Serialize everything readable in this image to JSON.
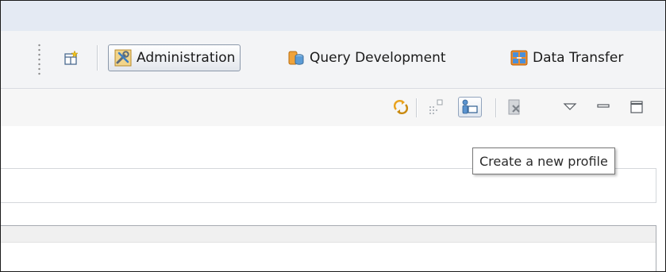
{
  "perspective_bar": {
    "items": [
      {
        "label": "Administration",
        "icon": "administration-icon",
        "active": true
      },
      {
        "label": "Query Development",
        "icon": "query-development-icon",
        "active": false
      },
      {
        "label": "Data Transfer",
        "icon": "data-transfer-icon",
        "active": false
      }
    ],
    "open_perspective_icon": "open-perspective-icon"
  },
  "view_toolbar": {
    "icons": [
      "sync-icon",
      "schema-tree-icon",
      "new-profile-icon",
      "disconnect-icon",
      "view-menu-icon",
      "minimize-icon",
      "maximize-icon"
    ]
  },
  "tooltip": {
    "text": "Create a new profile"
  },
  "colors": {
    "accent_border": "#8b98aa",
    "toolbar_bg": "#f3f4f6",
    "header_bg": "#e4eaf3"
  }
}
